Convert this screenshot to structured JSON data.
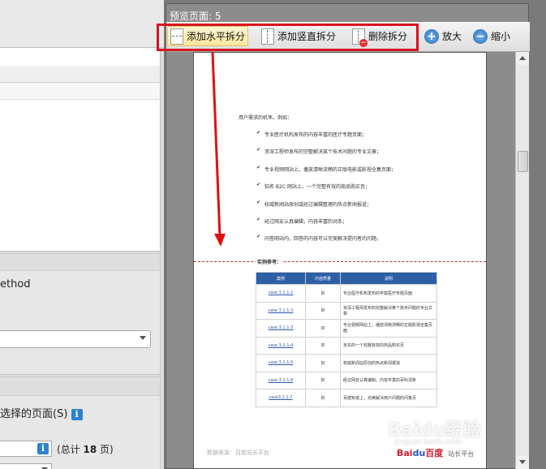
{
  "left_panel": {
    "method_label": "ethod",
    "pages_label": "选择的页面(S)",
    "info_icon_glyph": "i",
    "total_label": "(总计",
    "total_count": "18",
    "total_suffix": "页)"
  },
  "preview": {
    "title": "预览页面: 5",
    "toolbar": {
      "add_horizontal": "添加水平拆分",
      "add_vertical": "添加竖直拆分",
      "delete_split": "删除拆分",
      "zoom_in": "放大",
      "zoom_out": "缩小",
      "plus_glyph": "+",
      "minus_glyph": "−",
      "delete_glyph": "−"
    },
    "icons": {
      "horizontal_split": "doc-horizontal-split-icon",
      "vertical_split": "doc-vertical-split-icon",
      "delete_split": "doc-delete-split-icon",
      "zoom_in": "zoom-in-icon",
      "zoom_out": "zoom-out-icon"
    },
    "colors": {
      "highlight": "#d9121f",
      "table_header": "#2d5fa6",
      "link": "#2a58b0"
    }
  },
  "document": {
    "intro": "用户需求的机率。例如：",
    "bullets": [
      "专业医疗机构发布的内容丰富的医疗专题页面；",
      "资深工程师发布的完整解决某个技术问题的专业文章；",
      "专业视频网站上，播放清晰流畅的正版电影或影视全集页面；",
      "知名 B2C 网站上，一个完整有效的商品购买页；",
      "权威新闻站原创或经过编辑整理的热点新闻报道；",
      "经过网友认真编辑，内容丰富的词条；",
      "问答网站内，回答的内容可以完美解决提问者的问题。"
    ],
    "case_title": "实例参考：",
    "table": {
      "headers": [
        "案例",
        "内容质量",
        "说明"
      ],
      "rows": [
        [
          "case 3.1.1-1",
          "好",
          "专业医疗机构发布的丰富医疗专题页面"
        ],
        [
          "case 3.1.1-2",
          "好",
          "资深工程师发布的完整解决某个技术问题的专业文章"
        ],
        [
          "case 3.1.1-3",
          "好",
          "专业视频网站上，播放清晰流畅的正版影视全集页面"
        ],
        [
          "case 3.1.1-4",
          "好",
          "京东的一个完整有效的商品购买页"
        ],
        [
          "case 3.1.1-5",
          "好",
          "权威新闻站原创的热点新闻报道"
        ],
        [
          "case 3.1.1-6",
          "好",
          "经过网友认真编辑，内容丰富的百科词条"
        ],
        [
          "case3.1.1-7",
          "好",
          "百度知道上，完美解决用户问题的问答页"
        ]
      ]
    },
    "footer_source": "数据来源：百度站长平台",
    "footer_logo": "Bai",
    "footer_logo_paw": "du",
    "footer_logo_cn": "百度",
    "footer_logo_sub": "站长平台"
  },
  "watermark": {
    "text": "Baidu经验",
    "sub": "jingyan.baidu.com"
  }
}
